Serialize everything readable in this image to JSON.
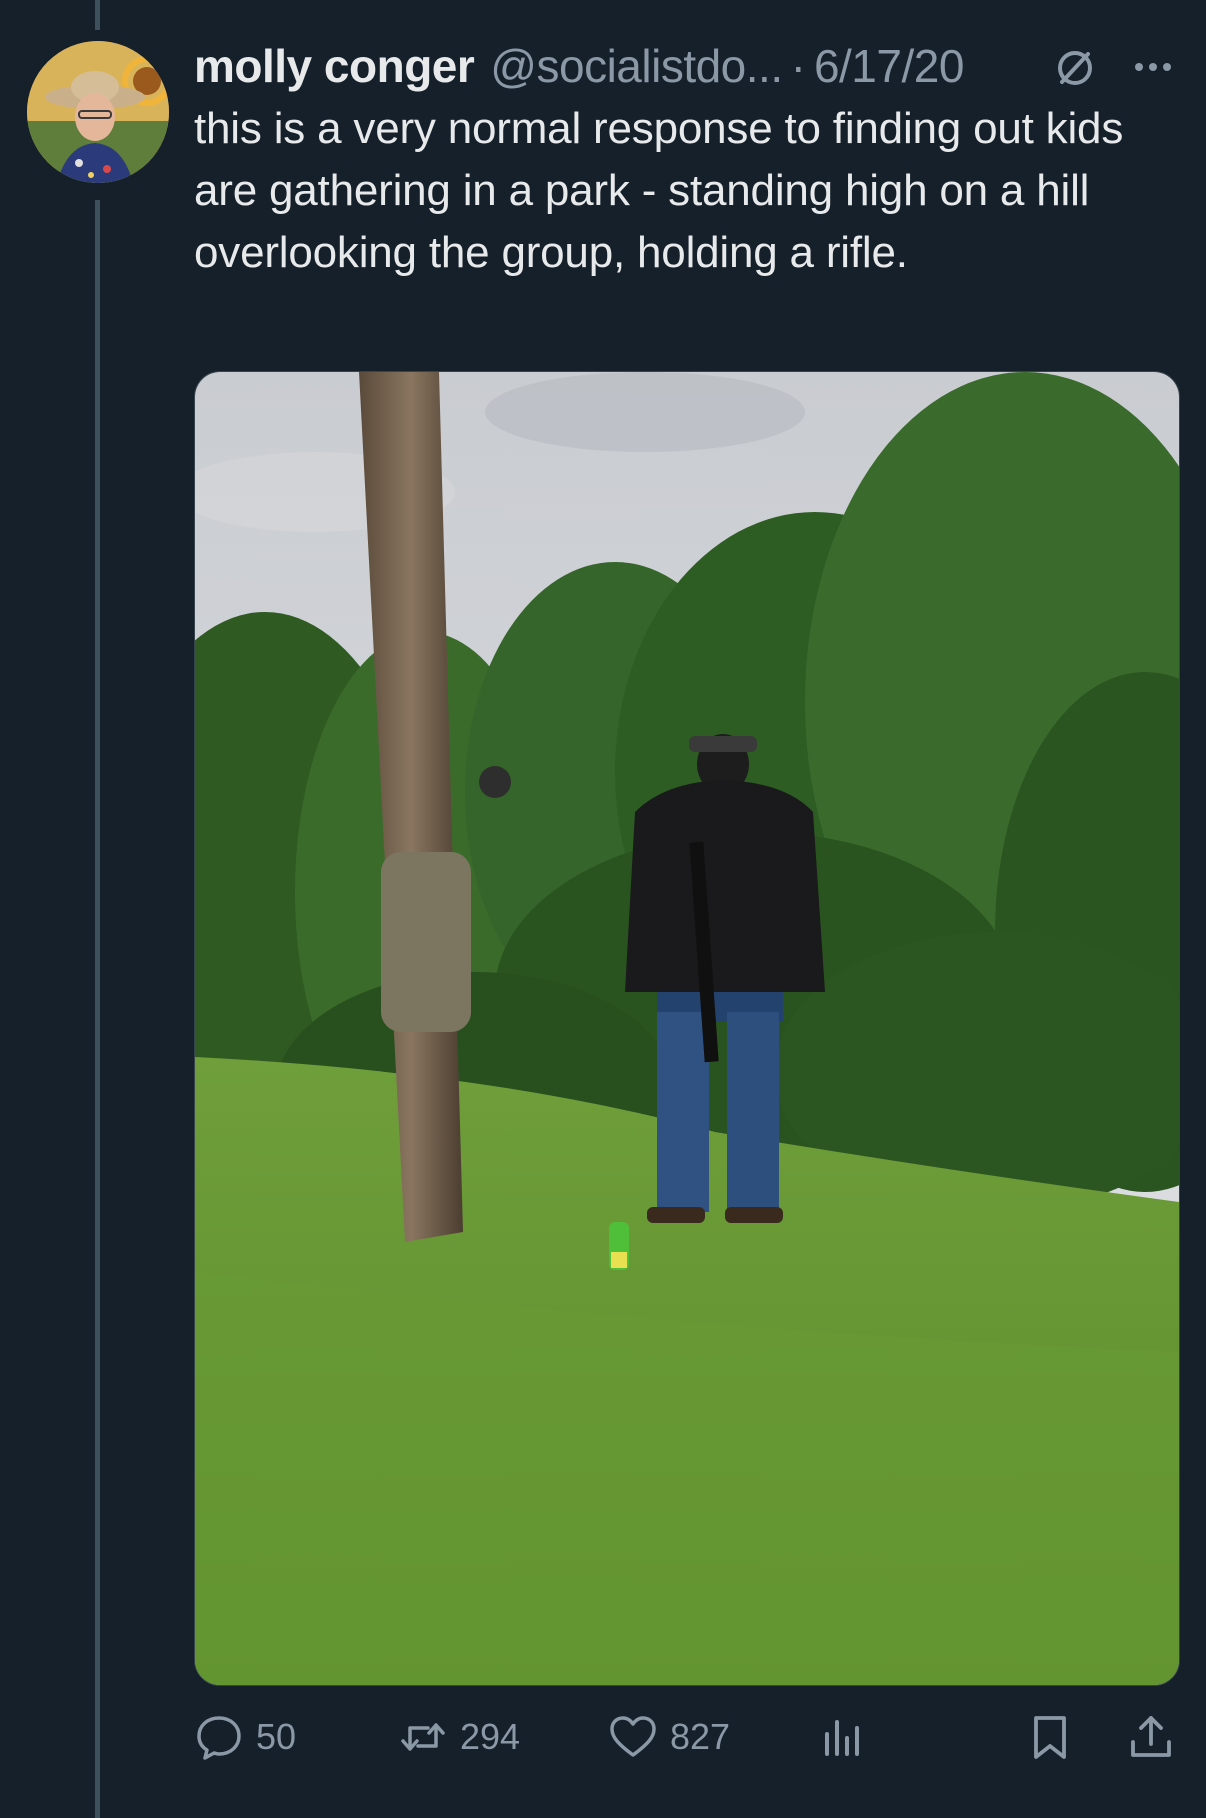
{
  "tweet": {
    "author_name": "molly conger",
    "handle": "@socialistdo...",
    "separator": "·",
    "date": "6/17/20",
    "text": "this is a very normal response to finding out kids are gathering in a park - standing high on a hill overlooking the group, holding a rifle."
  },
  "actions": {
    "reply_count": "50",
    "retweet_count": "294",
    "like_count": "827"
  },
  "icons": {
    "reply": "reply-icon",
    "retweet": "retweet-icon",
    "like": "heart-icon",
    "views": "analytics-icon",
    "bookmark": "bookmark-icon",
    "share": "share-icon",
    "more": "more-icon",
    "subscription": "subscription-icon"
  },
  "colors": {
    "background": "#15202b",
    "text_primary": "#e7e9ea",
    "text_secondary": "#8b98a5"
  }
}
